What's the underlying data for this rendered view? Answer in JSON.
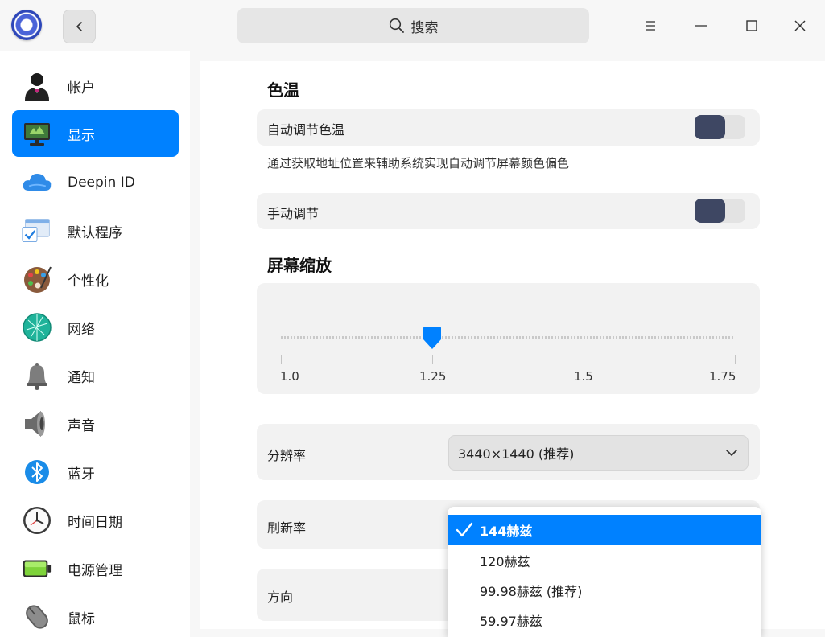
{
  "header": {
    "search_placeholder": "搜索",
    "app_logo_icon": "deepin-settings-icon",
    "back_icon": "chevron-left-icon",
    "menu_icon": "menu-icon",
    "minimize_icon": "minimize-icon",
    "maximize_icon": "maximize-icon",
    "close_icon": "close-icon"
  },
  "sidebar": {
    "items": [
      {
        "label": "帐户",
        "icon": "account-icon",
        "active": false
      },
      {
        "label": "显示",
        "icon": "display-icon",
        "active": true
      },
      {
        "label": "Deepin ID",
        "icon": "cloud-icon",
        "active": false
      },
      {
        "label": "默认程序",
        "icon": "default-apps-icon",
        "active": false
      },
      {
        "label": "个性化",
        "icon": "palette-icon",
        "active": false
      },
      {
        "label": "网络",
        "icon": "network-icon",
        "active": false
      },
      {
        "label": "通知",
        "icon": "bell-icon",
        "active": false
      },
      {
        "label": "声音",
        "icon": "speaker-icon",
        "active": false
      },
      {
        "label": "蓝牙",
        "icon": "bluetooth-icon",
        "active": false
      },
      {
        "label": "时间日期",
        "icon": "clock-icon",
        "active": false
      },
      {
        "label": "电源管理",
        "icon": "battery-icon",
        "active": false
      },
      {
        "label": "鼠标",
        "icon": "mouse-icon",
        "active": false
      }
    ]
  },
  "color_temp": {
    "title": "色温",
    "auto_label": "自动调节色温",
    "auto_on": false,
    "auto_desc": "通过获取地址位置来辅助系统实现自动调节屏幕颜色偏色",
    "manual_label": "手动调节",
    "manual_on": false
  },
  "scaling": {
    "title": "屏幕缩放",
    "ticks": [
      "1.0",
      "1.25",
      "1.5",
      "1.75"
    ],
    "value": "1.25"
  },
  "resolution": {
    "label": "分辨率",
    "value": "3440×1440 (推荐)"
  },
  "refresh": {
    "label": "刷新率",
    "options": [
      "144赫兹",
      "120赫兹",
      "99.98赫兹 (推荐)",
      "59.97赫兹"
    ],
    "selected": "144赫兹"
  },
  "orientation": {
    "label": "方向"
  },
  "colors": {
    "accent": "#0081ff",
    "toggle_knob": "#3e4763",
    "slider_handle": "#0081ff"
  }
}
